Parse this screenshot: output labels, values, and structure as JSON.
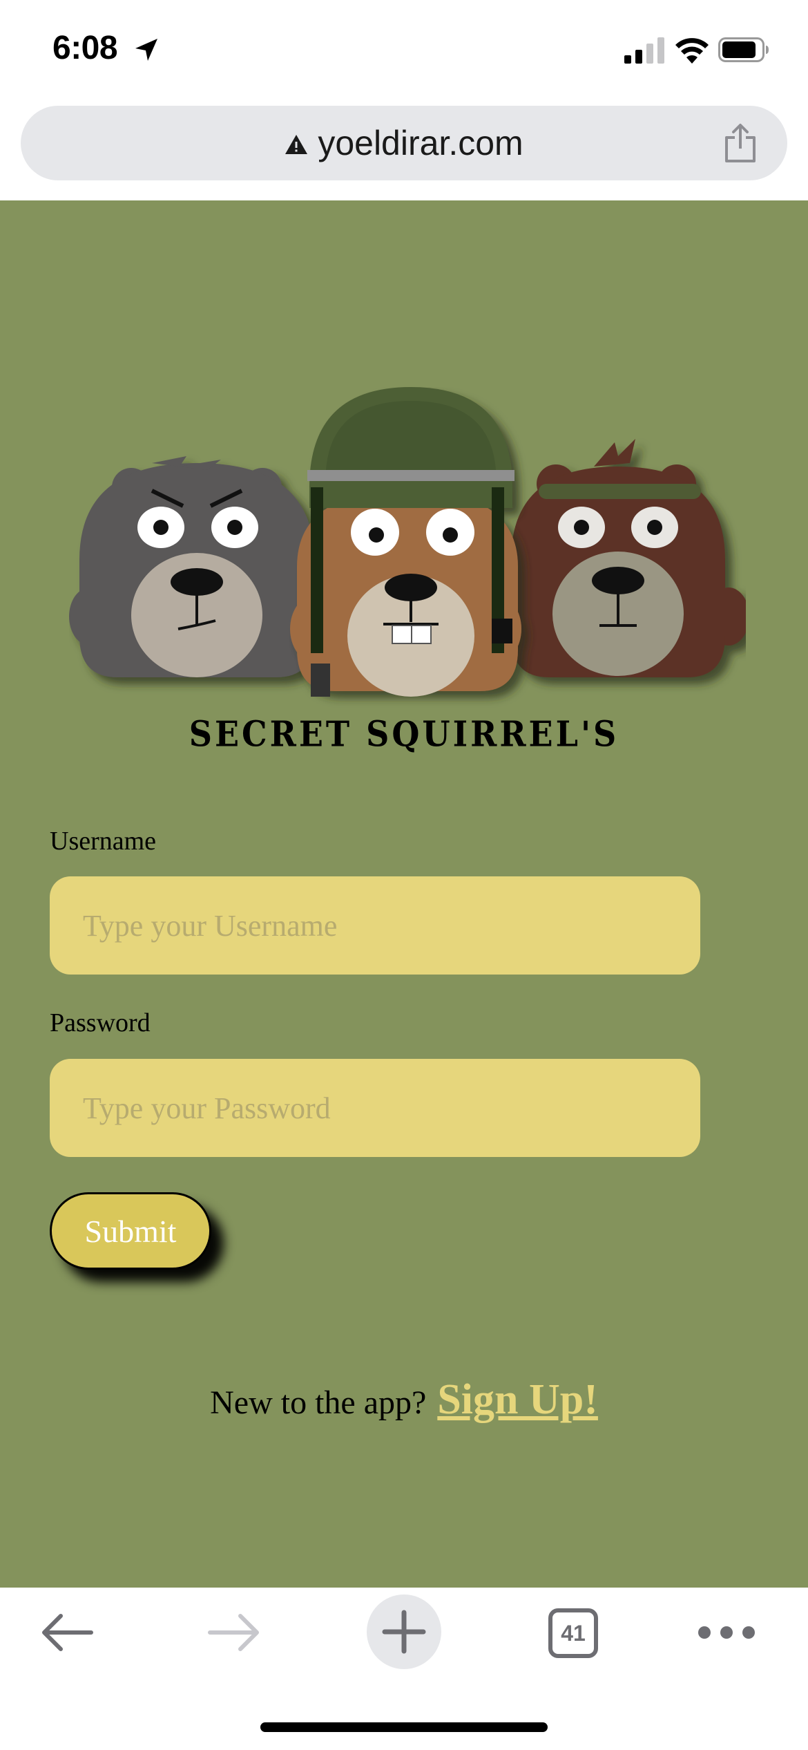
{
  "status_bar": {
    "time": "6:08",
    "icons": [
      "location-arrow-icon",
      "signal-icon",
      "wifi-icon",
      "battery-icon"
    ]
  },
  "browser": {
    "url": "yoeldirar.com",
    "icons": [
      "warning-icon",
      "share-icon"
    ]
  },
  "page": {
    "background_color": "#84935c",
    "accent_color": "#e6d67c",
    "brand_title": "SECRET SQUIRREL'S",
    "username": {
      "label": "Username",
      "placeholder": "Type your Username",
      "value": ""
    },
    "password": {
      "label": "Password",
      "placeholder": "Type your Password",
      "value": ""
    },
    "submit_label": "Submit",
    "signup_prompt": "New to the app?",
    "signup_link": "Sign Up!"
  },
  "toolbar": {
    "tab_count": "41",
    "icons": [
      "back-arrow-icon",
      "forward-arrow-icon",
      "new-tab-plus-icon",
      "tabs-icon",
      "more-icon"
    ]
  }
}
